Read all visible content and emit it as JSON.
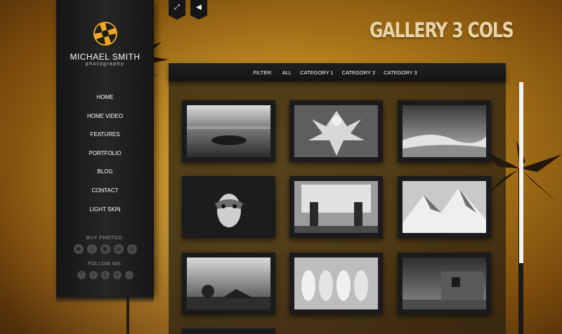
{
  "brand": {
    "name": "MICHAEL SMITH",
    "tagline": "photography"
  },
  "nav": {
    "items": [
      {
        "label": "HOME"
      },
      {
        "label": "HOME VIDEO"
      },
      {
        "label": "FEATURES"
      },
      {
        "label": "PORTFOLIO"
      },
      {
        "label": "BLOG"
      },
      {
        "label": "CONTACT"
      },
      {
        "label": "LIGHT SKIN"
      }
    ]
  },
  "buy_photos": {
    "label": "BUY PHOTOS:",
    "icons": [
      "camera-store-icon",
      "music-store-icon",
      "video-store-icon",
      "photo-store-icon",
      "globe-store-icon"
    ]
  },
  "follow_me": {
    "label": "FOLLOW ME:",
    "icons": [
      "facebook-icon",
      "twitter-icon",
      "google-plus-icon",
      "flickr-icon",
      "rss-icon"
    ]
  },
  "top_controls": {
    "fullscreen_icon": "expand-icon",
    "mute_icon": "mute-icon"
  },
  "page": {
    "heading": "GALLERY 3 COLS"
  },
  "filter": {
    "label": "FILTER:",
    "items": [
      "ALL",
      "CATEGORY 1",
      "CATEGORY 2",
      "CATEGORY 3"
    ]
  },
  "gallery": {
    "items": [
      {
        "subject": "sea-rocks"
      },
      {
        "subject": "statue"
      },
      {
        "subject": "dunes"
      },
      {
        "subject": "mask"
      },
      {
        "subject": "gas-station"
      },
      {
        "subject": "mountain"
      },
      {
        "subject": "barn"
      },
      {
        "subject": "geese"
      },
      {
        "subject": "shack"
      }
    ]
  },
  "colors": {
    "accent": "#f0a821",
    "sidebar": "#1e1e1e",
    "heading": "#e9d3a8"
  }
}
